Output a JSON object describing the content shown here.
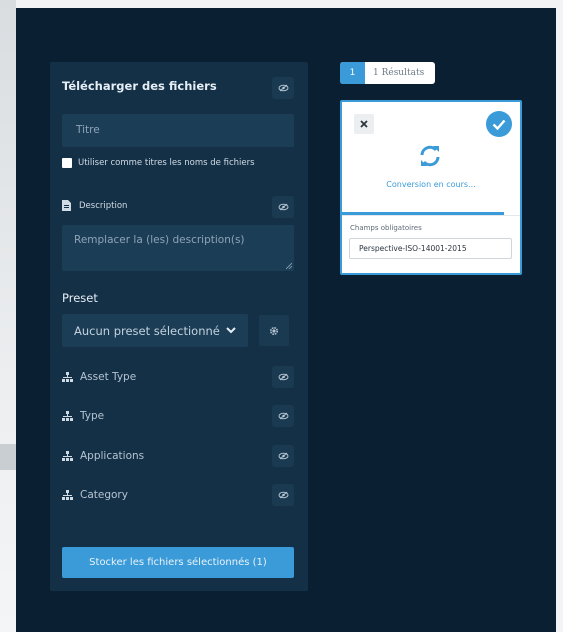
{
  "upload": {
    "title": "Télécharger des fichiers",
    "title_placeholder": "Titre",
    "use_filenames_label": "Utiliser comme titres les noms de fichiers",
    "description_label": "Description",
    "description_placeholder": "Remplacer la (les) description(s)",
    "preset_label": "Preset",
    "preset_value": "Aucun preset sélectionné",
    "taxonomy": [
      {
        "label": "Asset Type"
      },
      {
        "label": "Type"
      },
      {
        "label": "Applications"
      },
      {
        "label": "Category"
      }
    ],
    "store_button": "Stocker les fichiers sélectionnés (1)"
  },
  "results": {
    "count": "1",
    "label": "1 Résultats"
  },
  "card": {
    "status": "Conversion en cours...",
    "required_label": "Champs obligatoires",
    "required_value": "Perspective-ISO-14001-2015"
  },
  "colors": {
    "background": "#0b1f33",
    "panel": "#143047",
    "accent": "#3a9bd8"
  },
  "icons": [
    "eye-slash-icon",
    "document-icon",
    "chevron-down-icon",
    "gear-icon",
    "sitemap-icon",
    "close-icon",
    "check-icon",
    "sync-icon"
  ]
}
